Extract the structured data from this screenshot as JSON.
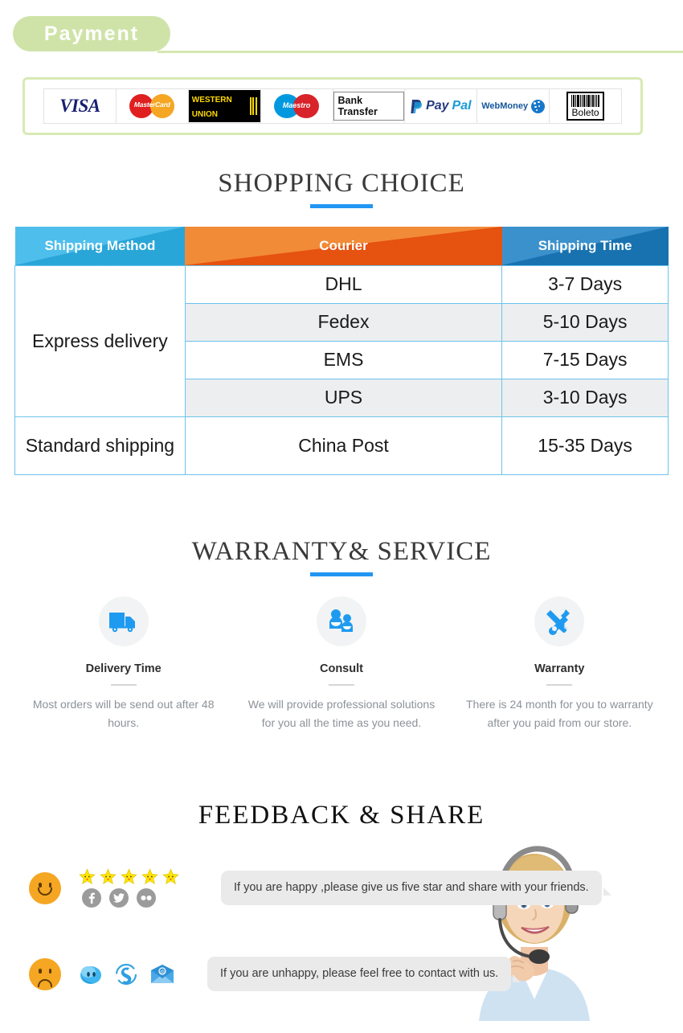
{
  "payment": {
    "heading": "Payment",
    "methods": [
      {
        "name": "visa",
        "label": "VISA"
      },
      {
        "name": "mastercard",
        "label": "MasterCard"
      },
      {
        "name": "western-union",
        "label_top": "WESTERN",
        "label_bottom": "UNION"
      },
      {
        "name": "maestro",
        "label": "Maestro"
      },
      {
        "name": "bank-transfer",
        "label": "Bank Transfer"
      },
      {
        "name": "paypal",
        "label_a": "Pay",
        "label_b": "Pal"
      },
      {
        "name": "webmoney",
        "label": "WebMoney"
      },
      {
        "name": "boleto",
        "label": "Boleto"
      }
    ]
  },
  "shopping_choice": {
    "title": "SHOPPING CHOICE",
    "columns": [
      "Shipping Method",
      "Courier",
      "Shipping Time"
    ],
    "rows": [
      {
        "method": "Express delivery",
        "method_rowspan": 4,
        "courier": "DHL",
        "time": "3-7  Days",
        "shaded": false
      },
      {
        "courier": "Fedex",
        "time": "5-10 Days",
        "shaded": true
      },
      {
        "courier": "EMS",
        "time": "7-15 Days",
        "shaded": false
      },
      {
        "courier": "UPS",
        "time": "3-10 Days",
        "shaded": true
      },
      {
        "method": "Standard shipping",
        "method_rowspan": 1,
        "courier": "China Post",
        "time": "15-35 Days",
        "shaded": false
      }
    ]
  },
  "warranty_service": {
    "title": "WARRANTY& SERVICE",
    "items": [
      {
        "icon": "truck-icon",
        "name": "Delivery Time",
        "desc": "Most orders will be send out after 48 hours."
      },
      {
        "icon": "people-icon",
        "name": "Consult",
        "desc": "We will provide professional solutions for you all the time as you need."
      },
      {
        "icon": "tools-icon",
        "name": "Warranty",
        "desc": "There is  24  month for you to warranty after you paid from our store."
      }
    ]
  },
  "feedback_share": {
    "title": "FEEDBACK & SHARE",
    "happy": {
      "face": "happy-face-icon",
      "star_count": 5,
      "social": [
        "facebook-icon",
        "twitter-icon",
        "flickr-icon"
      ],
      "message": "If you are happy ,please give us five star and share with your friends."
    },
    "unhappy": {
      "face": "sad-face-icon",
      "contacts": [
        "msn-icon",
        "skype-icon",
        "email-icon"
      ],
      "message": "If you are unhappy, please feel free to contact with us."
    },
    "agent_photo": "customer-service-agent-photo"
  },
  "colors": {
    "green_pill": "#cfe3a8",
    "green_rule": "#d6e8b0",
    "accent_blue": "#2196f3",
    "header_light_blue": "#2cb2e8",
    "header_orange": "#ef7a1a",
    "header_dark_blue": "#1b7fc4",
    "cell_border": "#6cc3ec",
    "row_shaded": "#eceeef",
    "icon_blue": "#2196f3",
    "smiley_orange": "#f5a623",
    "star_yellow": "#ffe400",
    "social_gray": "#9b9b9b",
    "bubble_gray": "#eaeaea"
  }
}
